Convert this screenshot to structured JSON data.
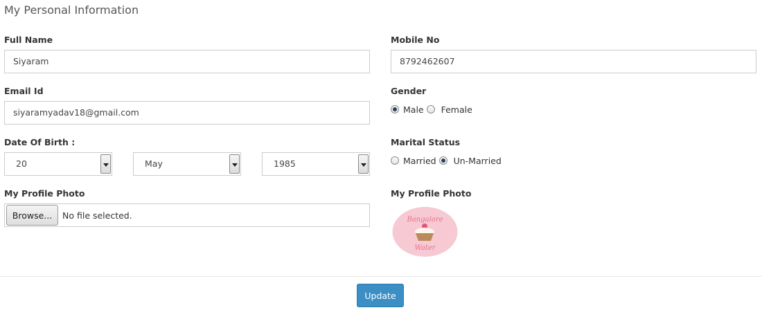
{
  "header": {
    "title": "My Personal Information"
  },
  "form": {
    "full_name": {
      "label": "Full Name",
      "value": "Siyaram"
    },
    "mobile": {
      "label": "Mobile No",
      "value": "8792462607"
    },
    "email": {
      "label": "Email Id",
      "value": "siyaramyadav18@gmail.com"
    },
    "gender": {
      "label": "Gender",
      "options": [
        {
          "label": "Male",
          "checked": true
        },
        {
          "label": "Female",
          "checked": false
        }
      ]
    },
    "dob": {
      "label": "Date Of Birth :",
      "day": "20",
      "month": "May",
      "year": "1985"
    },
    "marital": {
      "label": "Marital Status",
      "options": [
        {
          "label": "Married",
          "checked": false
        },
        {
          "label": "Un-Married",
          "checked": true
        }
      ]
    },
    "photo_upload": {
      "label": "My Profile Photo",
      "browse_label": "Browse...",
      "status": "No file selected."
    },
    "photo_preview": {
      "label": "My Profile Photo",
      "logo_line1": "Bangalore",
      "logo_line2": "Water"
    }
  },
  "actions": {
    "update_label": "Update"
  },
  "colors": {
    "primary_button": "#3b8fc5",
    "logo_bg": "#f6c9d3",
    "logo_text": "#e8708a"
  }
}
